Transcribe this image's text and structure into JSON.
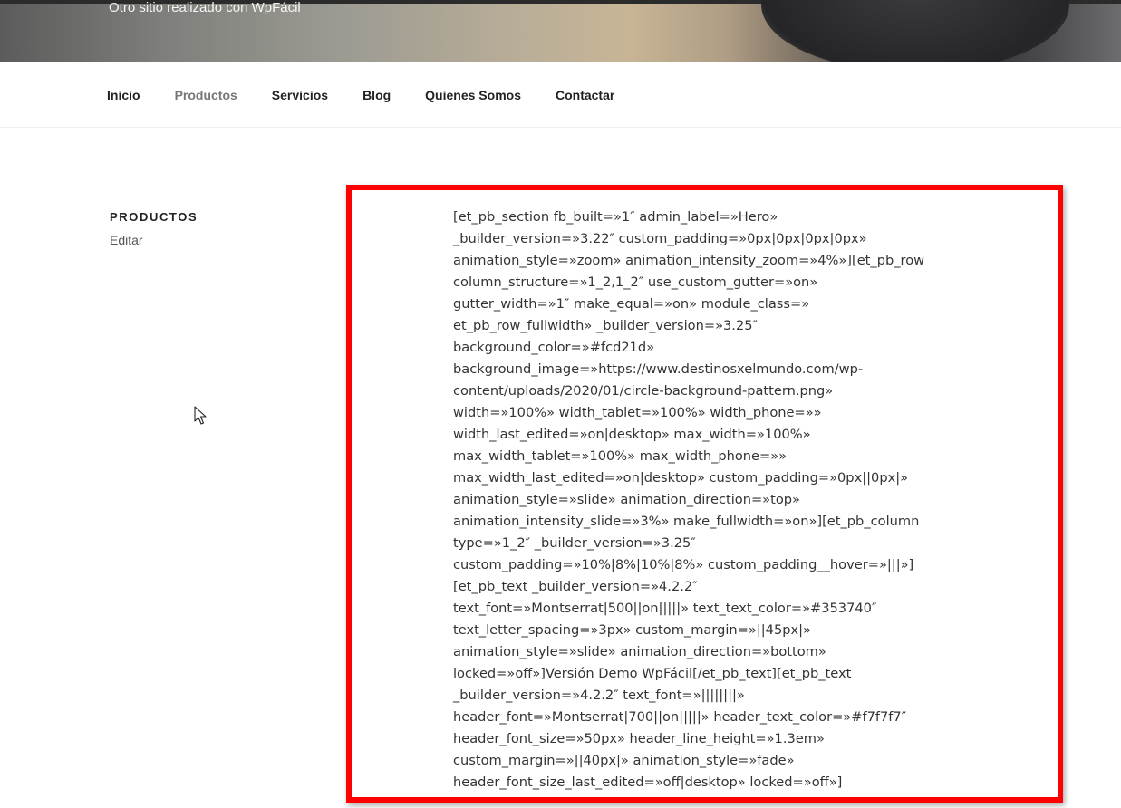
{
  "header": {
    "site_description": "Otro sitio realizado con WpFácil"
  },
  "nav": {
    "items": [
      {
        "label": "Inicio",
        "current": false
      },
      {
        "label": "Productos",
        "current": true
      },
      {
        "label": "Servicios",
        "current": false
      },
      {
        "label": "Blog",
        "current": false
      },
      {
        "label": "Quienes Somos",
        "current": false
      },
      {
        "label": "Contactar",
        "current": false
      }
    ]
  },
  "sidebar": {
    "page_title": "PRODUCTOS",
    "edit_link": "Editar"
  },
  "content": {
    "highlight_color": "#ff0000",
    "lines": [
      "[et_pb_section fb_built=»1″ admin_label=»Hero»",
      "_builder_version=»3.22″ custom_padding=»0px|0px|0px|0px»",
      "animation_style=»zoom» animation_intensity_zoom=»4%»][et_pb_row",
      "column_structure=»1_2,1_2″ use_custom_gutter=»on»",
      "gutter_width=»1″ make_equal=»on» module_class=»",
      "et_pb_row_fullwidth» _builder_version=»3.25″",
      "background_color=»#fcd21d»",
      "background_image=»https://www.destinosxelmundo.com/wp-",
      "content/uploads/2020/01/circle-background-pattern.png»",
      "width=»100%» width_tablet=»100%» width_phone=»»",
      "width_last_edited=»on|desktop» max_width=»100%»",
      "max_width_tablet=»100%» max_width_phone=»»",
      "max_width_last_edited=»on|desktop» custom_padding=»0px||0px|»",
      "animation_style=»slide» animation_direction=»top»",
      "animation_intensity_slide=»3%» make_fullwidth=»on»][et_pb_column",
      "type=»1_2″ _builder_version=»3.25″",
      "custom_padding=»10%|8%|10%|8%» custom_padding__hover=»|||»]",
      "[et_pb_text _builder_version=»4.2.2″",
      "text_font=»Montserrat|500||on|||||» text_text_color=»#353740″",
      "text_letter_spacing=»3px» custom_margin=»||45px|»",
      "animation_style=»slide» animation_direction=»bottom»",
      "locked=»off»]Versión Demo WpFácil[/et_pb_text][et_pb_text",
      "_builder_version=»4.2.2″ text_font=»||||||||»",
      "header_font=»Montserrat|700||on|||||» header_text_color=»#f7f7f7″",
      "header_font_size=»50px» header_line_height=»1.3em»",
      "custom_margin=»||40px|» animation_style=»fade»",
      "header_font_size_last_edited=»off|desktop» locked=»off»]"
    ]
  }
}
